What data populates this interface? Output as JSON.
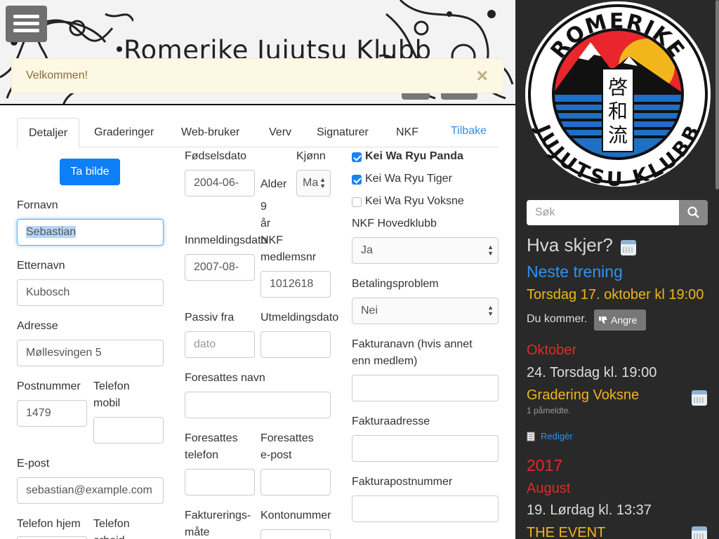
{
  "header": {
    "site_title": "Romerike Jujutsu Klubb",
    "alert_text": "Velkommen!",
    "alert_close": "×"
  },
  "tabs": [
    "Detaljer",
    "Graderinger",
    "Web-bruker",
    "Verv",
    "Signaturer",
    "NKF"
  ],
  "back_link": "Tilbake",
  "photo_button": "Ta bilde",
  "fields": {
    "first_name": {
      "label": "Fornavn",
      "value": "Sebastian"
    },
    "last_name": {
      "label": "Etternavn",
      "value": "Kubosch"
    },
    "address": {
      "label": "Adresse",
      "value": "Møllesvingen 5"
    },
    "postal_code": {
      "label": "Postnummer",
      "value": "1479"
    },
    "mobile": {
      "label_line1": "Telefon",
      "label_line2": "mobil",
      "value": ""
    },
    "email": {
      "label": "E-post",
      "value": "sebastian@example.com"
    },
    "home_phone": {
      "label": "Telefon hjem"
    },
    "work_phone": {
      "label_line1": "Telefon",
      "label_line2": "arbeid"
    },
    "birth_date": {
      "label": "Fødselsdato",
      "value": "2004-06-"
    },
    "gender": {
      "label": "Kjønn",
      "value": "Ma"
    },
    "age": {
      "label": "Alder",
      "value": "9",
      "unit": "år"
    },
    "join_date": {
      "label": "Innmeldingsdato",
      "value": "2007-08-"
    },
    "nkf_number": {
      "label_line1": "NKF",
      "label_line2": "medlemsnr",
      "value": "1012618"
    },
    "passive_from": {
      "label": "Passiv fra",
      "placeholder": "dato"
    },
    "exit_date": {
      "label": "Utmeldingsdato"
    },
    "guardian_name": {
      "label": "Foresattes navn"
    },
    "guardian_phone": {
      "label_line1": "Foresattes",
      "label_line2": "telefon"
    },
    "guardian_email": {
      "label_line1": "Foresattes",
      "label_line2": "e-post"
    },
    "invoice_method": {
      "label_line1": "Fakturerings-",
      "label_line2": "måte"
    },
    "account_number": {
      "label": "Kontonummer"
    },
    "groups": [
      {
        "label": "Kei Wa Ryu Panda",
        "checked": true
      },
      {
        "label": "Kei Wa Ryu Tiger",
        "checked": true
      },
      {
        "label": "Kei Wa Ryu Voksne",
        "checked": false
      }
    ],
    "nkf_main_club": {
      "label": "NKF Hovedklubb",
      "value": "Ja"
    },
    "payment_problem": {
      "label": "Betalingsproblem",
      "value": "Nei"
    },
    "invoice_name": {
      "label_line1": "Fakturanavn (hvis annet",
      "label_line2": "enn medlem)"
    },
    "invoice_address": {
      "label": "Fakturaadresse"
    },
    "invoice_postal": {
      "label": "Fakturapostnummer"
    }
  },
  "sidebar": {
    "logo_top_text": "ROMERIKE",
    "logo_bottom_text": "JUJUTSU KLUBB",
    "logo_kanji": [
      "啓",
      "和",
      "流"
    ],
    "search_placeholder": "Søk",
    "whats_on": "Hva skjer?",
    "next_training_heading": "Neste trening",
    "next_training_time": "Torsdag 17. oktober kl 19:00",
    "attending_text": "Du kommer.",
    "undo_button": "Angre",
    "month_1": "Oktober",
    "event_1_time": "24. Torsdag kl. 19:00",
    "event_1_title": "Gradering Voksne",
    "event_1_count": "1 påmeldte.",
    "edit_link": "Redigèr",
    "year": "2017",
    "month_2": "August",
    "event_2_time": "19. Lørdag kl. 13:37",
    "event_2_title": "THE EVENT"
  },
  "colors": {
    "primary": "#0d7ff7",
    "link": "#2f8ee5",
    "sidebar_bg": "#292929",
    "sidebar_blue": "#2e93f0",
    "sidebar_yellow": "#f2b51b",
    "sidebar_red": "#e8262c",
    "alert_bg": "#fcf8e3"
  }
}
